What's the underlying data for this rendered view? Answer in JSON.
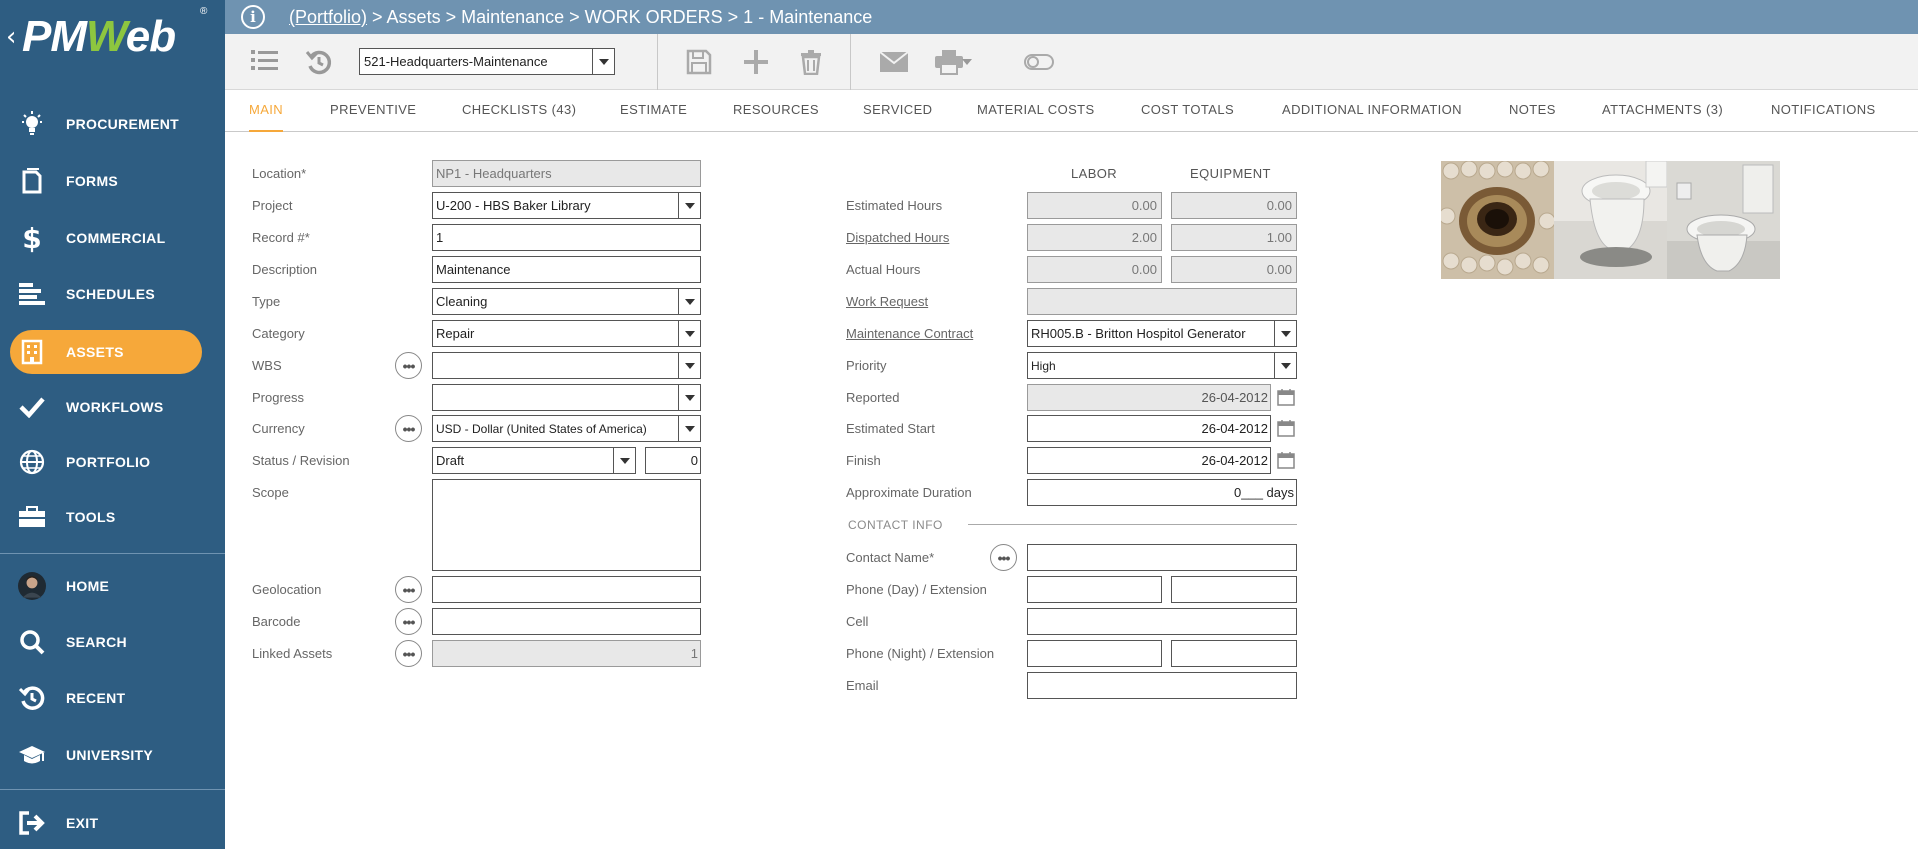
{
  "app": {
    "logo_text_pm": "PM",
    "logo_text_w": "W",
    "logo_text_eb": "eb",
    "logo_reg": "®"
  },
  "sidebar": {
    "items": [
      {
        "label": "PROCUREMENT",
        "icon": "lightbulb-icon"
      },
      {
        "label": "FORMS",
        "icon": "document-icon"
      },
      {
        "label": "COMMERCIAL",
        "icon": "dollar-icon"
      },
      {
        "label": "SCHEDULES",
        "icon": "gantt-icon"
      },
      {
        "label": "ASSETS",
        "icon": "building-icon",
        "active": true
      },
      {
        "label": "WORKFLOWS",
        "icon": "checkmark-icon"
      },
      {
        "label": "PORTFOLIO",
        "icon": "globe-icon"
      },
      {
        "label": "TOOLS",
        "icon": "toolbox-icon"
      },
      {
        "label": "HOME",
        "icon": "avatar"
      },
      {
        "label": "SEARCH",
        "icon": "search-icon"
      },
      {
        "label": "RECENT",
        "icon": "recent-icon"
      },
      {
        "label": "UNIVERSITY",
        "icon": "graduation-cap-icon"
      },
      {
        "label": "EXIT",
        "icon": "exit-icon"
      }
    ]
  },
  "header": {
    "breadcrumb_link": "(Portfolio)",
    "breadcrumb_rest": " > Assets > Maintenance > WORK ORDERS > 1 - Maintenance"
  },
  "toolbar": {
    "record_select": "521-Headquarters-Maintenance"
  },
  "tabs": [
    {
      "label": "MAIN",
      "active": true
    },
    {
      "label": "PREVENTIVE"
    },
    {
      "label": "CHECKLISTS (43)"
    },
    {
      "label": "ESTIMATE"
    },
    {
      "label": "RESOURCES"
    },
    {
      "label": "SERVICED"
    },
    {
      "label": "MATERIAL COSTS"
    },
    {
      "label": "COST TOTALS"
    },
    {
      "label": "ADDITIONAL INFORMATION"
    },
    {
      "label": "NOTES"
    },
    {
      "label": "ATTACHMENTS (3)"
    },
    {
      "label": "NOTIFICATIONS"
    }
  ],
  "left_form": {
    "location": {
      "label": "Location*",
      "value": "NP1 - Headquarters"
    },
    "project": {
      "label": "Project",
      "value": "U-200 - HBS Baker Library"
    },
    "record": {
      "label": "Record #*",
      "value": "1"
    },
    "description": {
      "label": "Description",
      "value": "Maintenance"
    },
    "type": {
      "label": "Type",
      "value": "Cleaning"
    },
    "category": {
      "label": "Category",
      "value": "Repair"
    },
    "wbs": {
      "label": "WBS",
      "value": ""
    },
    "progress": {
      "label": "Progress",
      "value": ""
    },
    "currency": {
      "label": "Currency",
      "value": "USD - Dollar (United States of America)"
    },
    "status": {
      "label": "Status / Revision",
      "value": "Draft",
      "revision": "0"
    },
    "scope": {
      "label": "Scope",
      "value": ""
    },
    "geolocation": {
      "label": "Geolocation",
      "value": ""
    },
    "barcode": {
      "label": "Barcode",
      "value": ""
    },
    "linked_assets": {
      "label": "Linked Assets",
      "value": "1"
    }
  },
  "right_form": {
    "col_labor": "LABOR",
    "col_equipment": "EQUIPMENT",
    "estimated_hours": {
      "label": "Estimated Hours",
      "labor": "0.00",
      "equipment": "0.00"
    },
    "dispatched_hours": {
      "label": "Dispatched Hours",
      "labor": "2.00",
      "equipment": "1.00"
    },
    "actual_hours": {
      "label": "Actual Hours",
      "labor": "0.00",
      "equipment": "0.00"
    },
    "work_request": {
      "label": "Work Request",
      "value": ""
    },
    "maintenance_contract": {
      "label": "Maintenance Contract",
      "value": "RH005.B - Britton Hospitol Generator"
    },
    "priority": {
      "label": "Priority",
      "value": "High"
    },
    "reported": {
      "label": "Reported",
      "value": "26-04-2012"
    },
    "estimated_start": {
      "label": "Estimated Start",
      "value": "26-04-2012"
    },
    "finish": {
      "label": "Finish",
      "value": "26-04-2012"
    },
    "approximate_duration": {
      "label": "Approximate Duration",
      "value": "0___ days"
    },
    "contact_info_title": "CONTACT INFO",
    "contact_name": {
      "label": "Contact Name*",
      "value": ""
    },
    "phone_day": {
      "label": "Phone (Day) / Extension",
      "value": "",
      "ext": ""
    },
    "cell": {
      "label": "Cell",
      "value": ""
    },
    "phone_night": {
      "label": "Phone (Night) / Extension",
      "value": "",
      "ext": ""
    },
    "email": {
      "label": "Email",
      "value": ""
    }
  },
  "colors": {
    "sidebar": "#2e5d82",
    "topbar": "#6f93b1",
    "accent": "#f6a83a",
    "logo_w": "#8dc63f"
  }
}
